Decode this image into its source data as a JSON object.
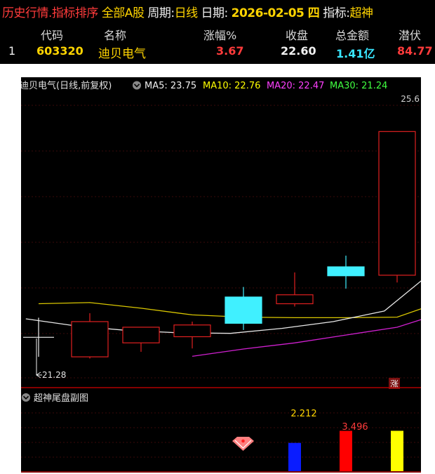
{
  "header": {
    "history_menu": "历史行情.指标排序",
    "market": "全部A股",
    "period_label": "周期:",
    "period_value": "日线",
    "date_label": "日期:",
    "date_value": "2026-02-05 四",
    "indicator_label": "指标:",
    "indicator_value": "超神"
  },
  "table": {
    "columns": [
      "代码",
      "名称",
      "涨幅%",
      "收盘",
      "总金额",
      "潜伏"
    ],
    "rows": [
      {
        "index": "1",
        "code": "603320",
        "name": "迪贝电气",
        "change": "3.67",
        "close": "22.60",
        "amount": "1.41亿",
        "latent": "84.77"
      }
    ]
  },
  "chart": {
    "title": "迪贝电气(日线,前复权)",
    "ma": [
      {
        "label": "MA5: 23.75",
        "color": "#f0f0f0"
      },
      {
        "label": "MA10: 22.76",
        "color": "#ffff00"
      },
      {
        "label": "MA20: 22.47",
        "color": "#ff40ff"
      },
      {
        "label": "MA30: 21.24",
        "color": "#40ff40"
      }
    ],
    "price_high_label": "25.6",
    "price_low_label": "21.28",
    "zhang_label": "涨",
    "sub_title": "超神尾盘副图",
    "sub_labels": [
      "2.212",
      "3.496"
    ]
  },
  "chart_data": {
    "type": "candlestick",
    "ylim": [
      20.95,
      26.1
    ],
    "candles": [
      {
        "o": 21.7,
        "c": 21.7,
        "h": 22.05,
        "l": 21.35
      },
      {
        "o": 21.35,
        "c": 21.98,
        "h": 22.13,
        "l": 21.32
      },
      {
        "o": 21.6,
        "c": 21.88,
        "h": 21.88,
        "l": 21.44
      },
      {
        "o": 21.71,
        "c": 21.92,
        "h": 21.98,
        "l": 21.5
      },
      {
        "o": 22.42,
        "c": 21.95,
        "h": 22.6,
        "l": 21.83
      },
      {
        "o": 22.3,
        "c": 22.46,
        "h": 22.86,
        "l": 22.25
      },
      {
        "o": 22.96,
        "c": 22.8,
        "h": 23.16,
        "l": 22.57
      },
      {
        "o": 22.81,
        "c": 25.38,
        "h": 25.38,
        "l": 22.68
      }
    ],
    "ma5": [
      [
        -0.25,
        22.03
      ],
      [
        0.75,
        21.9
      ],
      [
        1.75,
        21.82
      ],
      [
        2.75,
        21.78
      ],
      [
        3.75,
        21.77
      ],
      [
        4.75,
        21.86
      ],
      [
        5.75,
        21.98
      ],
      [
        6.75,
        22.17
      ],
      [
        7.75,
        22.92
      ],
      [
        8.25,
        23.21
      ]
    ],
    "ma10": [
      [
        0,
        22.3
      ],
      [
        1,
        22.32
      ],
      [
        2,
        22.22
      ],
      [
        3,
        22.1
      ],
      [
        4,
        22.06
      ],
      [
        5,
        22.05
      ],
      [
        6,
        22.05
      ],
      [
        7,
        22.06
      ],
      [
        8,
        22.38
      ],
      [
        8.25,
        22.47
      ]
    ],
    "ma20": [
      [
        3,
        21.36
      ],
      [
        4,
        21.49
      ],
      [
        5,
        21.6
      ],
      [
        6,
        21.74
      ],
      [
        7,
        21.88
      ],
      [
        8,
        22.17
      ],
      [
        8.25,
        22.27
      ]
    ],
    "sub": [
      {
        "index": 5,
        "value": 1.55,
        "color": "#0a1cff"
      },
      {
        "index": 6,
        "value": 2.212,
        "color": "#ff0000"
      },
      {
        "index": 7,
        "value": 2.212,
        "color": "#ffff00"
      }
    ],
    "sub_ylim": [
      0,
      3.5
    ]
  }
}
